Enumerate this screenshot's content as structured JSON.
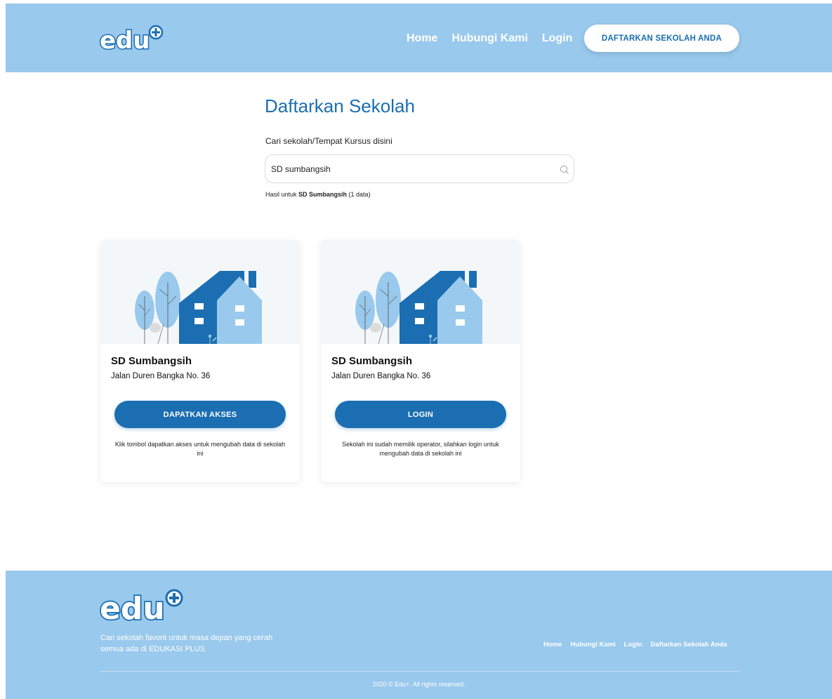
{
  "header": {
    "logo": "edu+",
    "nav": [
      "Home",
      "Hubungi Kami",
      "Login"
    ],
    "cta_label": "DAFTARKAN SEKOLAH ANDA"
  },
  "main": {
    "title": "Daftarkan Sekolah",
    "search_label": "Cari sekolah/Tempat Kursus disini",
    "search_value": "SD sumbangsih",
    "result_prefix": "Hasil untuk ",
    "result_query": "SD Sumbangsih",
    "result_suffix": " (1 data)"
  },
  "cards": [
    {
      "name": "SD Sumbangsih",
      "address": "Jalan Duren Bangka No. 36",
      "button": "DAPATKAN AKSES",
      "note": "Klik tombol dapatkan akses untuk mengubah data di sekolah ini"
    },
    {
      "name": "SD Sumbangsih",
      "address": "Jalan Duren Bangka No. 36",
      "button": "LOGIN",
      "note": "Sekolah ini sudah memilik operator, silahkan login untuk mengubah data di sekolah ini"
    }
  ],
  "footer": {
    "logo": "edu+",
    "tagline_line1": "Cari sekolah favorit untuk masa depan yang cerah",
    "tagline_line2": "semua ada di EDUKASI PLUS",
    "nav": [
      "Home",
      "Hubungi Kami",
      "Login",
      "Daftarkan Sekolah Anda"
    ],
    "copyright": "2020 © Edu+. All rights reserved."
  },
  "colors": {
    "brand_blue": "#1b6eb1",
    "light_blue": "#99c9ec",
    "card_illustration_bg": "#f4f7fa"
  },
  "icons": {
    "search": "search-icon"
  }
}
